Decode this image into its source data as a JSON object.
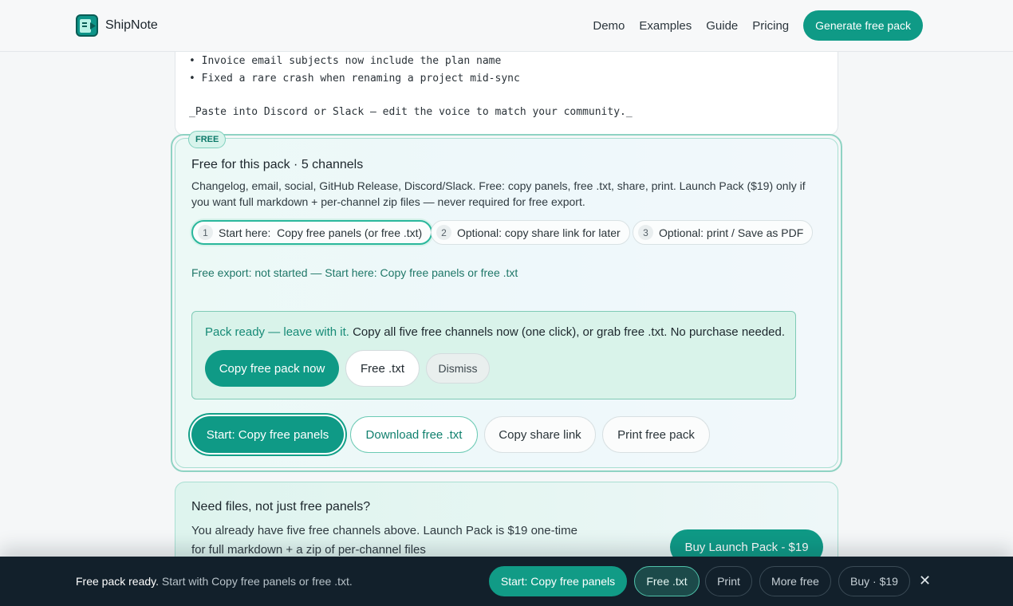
{
  "header": {
    "brand": "ShipNote",
    "nav": [
      "Demo",
      "Examples",
      "Guide",
      "Pricing"
    ],
    "cta": "Generate free pack"
  },
  "code_card": {
    "lines": [
      "• Invoice email subjects now include the plan name",
      "• Fixed a rare crash when renaming a project mid-sync",
      "_Paste into Discord or Slack — edit the voice to match your community._"
    ]
  },
  "free_card": {
    "badge": "FREE",
    "title": "Free for this pack · 5 channels",
    "description": "Changelog, email, social, GitHub Release, Discord/Slack. Free: copy panels, free .txt, share, print. Launch Pack ($19) only if you want full markdown + per-channel zip files — never required for free export.",
    "steps": [
      {
        "num": "1",
        "label": "Start here:  Copy free panels (or free .txt)"
      },
      {
        "num": "2",
        "label": "Optional: copy share link for later"
      },
      {
        "num": "3",
        "label": "Optional: print / Save as PDF"
      }
    ],
    "status": "Free export: not started — Start here: Copy free panels or free .txt",
    "ready": {
      "lead": "Pack ready — leave with it.",
      "text": " Copy all five free channels now (one click), or grab free .txt. No purchase needed.",
      "copy_button": "Copy free pack now",
      "txt_button": "Free .txt",
      "dismiss_button": "Dismiss"
    },
    "actions": {
      "start": "Start: Copy free panels",
      "download": "Download free .txt",
      "share": "Copy share link",
      "print": "Print free pack"
    }
  },
  "files_card": {
    "title": "Need files, not just free panels?",
    "description": "You already have five free channels above. Launch Pack is $19 one-time for full markdown + a zip of per-channel files",
    "buy_button": "Buy Launch Pack - $19"
  },
  "bottom_bar": {
    "lead": "Free pack ready.",
    "sub": " Start with Copy free panels or free .txt.",
    "buttons": {
      "start": "Start: Copy free panels",
      "txt": "Free .txt",
      "print": "Print",
      "more": "More free",
      "buy": "Buy · $19"
    },
    "close": "✕"
  },
  "colors": {
    "accent": "#0f9a86",
    "bar": "#12202b",
    "panel_tint": "#d9f3ea"
  }
}
